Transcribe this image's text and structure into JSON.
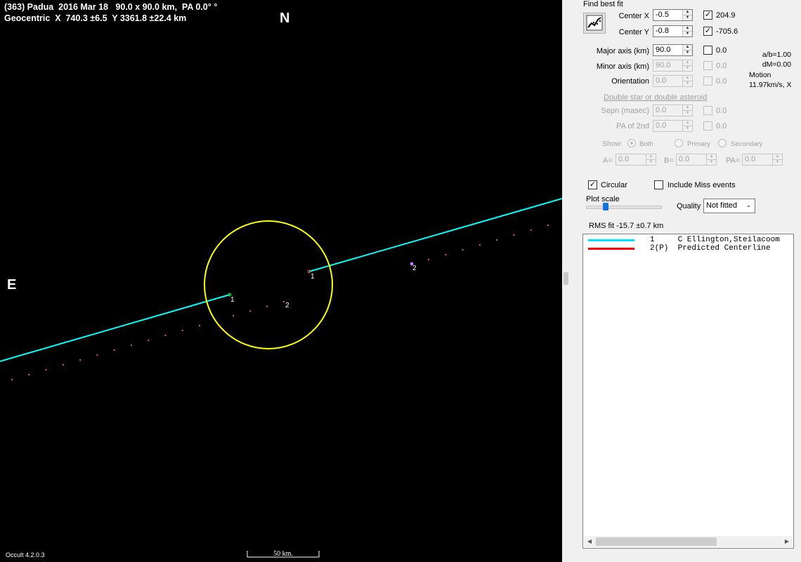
{
  "plot": {
    "title_line1": "(363) Padua  2016 Mar 18   90.0 x 90.0 km,  PA 0.0° °",
    "title_line2": "Geocentric  X  740.3 ±6.5  Y 3361.8 ±22.4 km",
    "north_label": "N",
    "east_label": "E",
    "version": "Occult 4.2.0.3",
    "scale_label": "50 km.",
    "chord_labels": [
      "1",
      "1",
      "2",
      "2"
    ],
    "colors": {
      "background": "#000000",
      "ellipse": "#ffff00",
      "chord": "#00ffff",
      "predicted_dots": "#ff5a5a"
    }
  },
  "panel": {
    "find_best_fit": "Find best fit",
    "center_x_label": "Center X",
    "center_x_value": "-0.5",
    "center_x_result": "204.9",
    "center_y_label": "Center Y",
    "center_y_value": "-0.8",
    "center_y_result": "-705.6",
    "major_axis_label": "Major axis (km)",
    "major_axis_value": "90.0",
    "major_axis_result": "0.0",
    "minor_axis_label": "Minor axis (km)",
    "minor_axis_value": "90.0",
    "minor_axis_result": "0.0",
    "orientation_label": "Orientation",
    "orientation_value": "0.0",
    "orientation_result": "0.0",
    "ab_ratio": "a/b=1.00",
    "dm": "dM=0.00",
    "motion_label": "Motion",
    "motion_value": "11.97km/s, X",
    "double_star_link": "Double star  or  double asteroid",
    "sepn_label": "Sepn (masec)",
    "sepn_value": "0.0",
    "sepn_result": "0.0",
    "pa2_label": "PA of 2nd",
    "pa2_value": "0.0",
    "pa2_result": "0.0",
    "show_label": "Show:",
    "radio_both": "Both",
    "radio_primary": "Primary",
    "radio_secondary": "Secondary",
    "a_label": "A=",
    "a_value": "0.0",
    "b_label": "B=",
    "b_value": "0.0",
    "pa_label": "PA=",
    "pa_value": "0.0",
    "circular_label": "Circular",
    "circular_checked": "✓",
    "include_miss_label": "Include Miss events",
    "plot_scale_label": "Plot scale",
    "quality_label": "Quality",
    "quality_value": "Not fitted",
    "rms_fit": "RMS fit  -15.7 ±0.7 km"
  },
  "results": [
    {
      "num": "1",
      "text": "1     C Ellington,Steilacoom",
      "color": "#00e5ff"
    },
    {
      "num": "2",
      "text": "2(P)  Predicted Centerline",
      "color": "#ff0000"
    }
  ]
}
